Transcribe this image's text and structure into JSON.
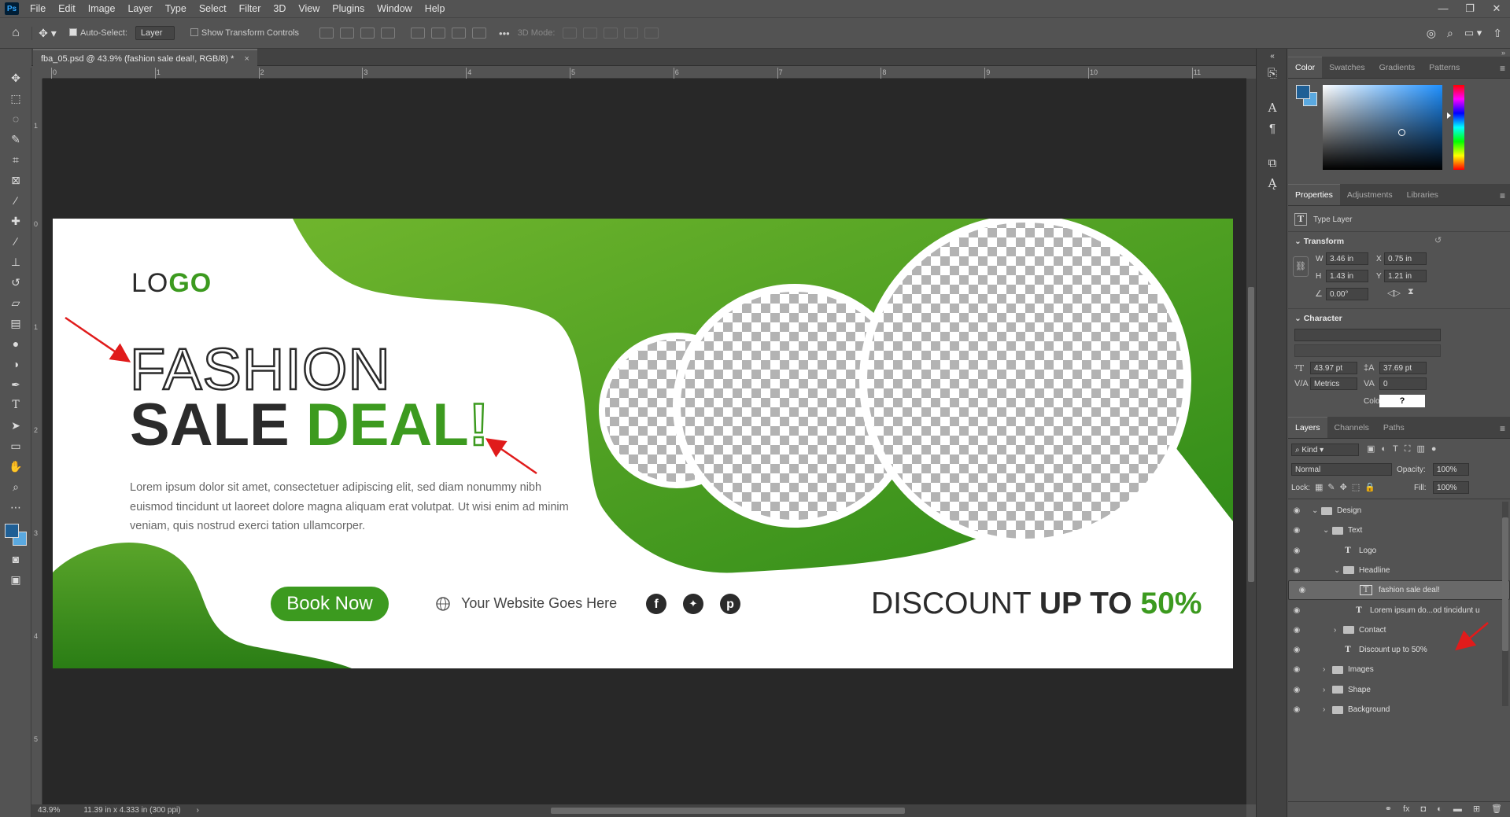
{
  "app": {
    "name": "Ps"
  },
  "menu": [
    "File",
    "Edit",
    "Image",
    "Layer",
    "Type",
    "Select",
    "Filter",
    "3D",
    "View",
    "Plugins",
    "Window",
    "Help"
  ],
  "window_controls": [
    "—",
    "❐",
    "✕"
  ],
  "options_bar": {
    "auto_select_label": "Auto-Select:",
    "auto_select_value": "Layer",
    "transform_label": "Show Transform Controls",
    "more": "•••",
    "mode_3d": "3D Mode:"
  },
  "document": {
    "tab_title": "fba_05.psd @ 43.9% (fashion sale deal!, RGB/8) *",
    "tab_close": "×",
    "zoom": "43.9%",
    "doc_size": "11.39 in x 4.333 in (300 ppi)"
  },
  "rulers": {
    "h": [
      "0",
      "1",
      "2",
      "3",
      "4",
      "5",
      "6",
      "7",
      "8",
      "9",
      "10",
      "11"
    ],
    "v": [
      "1",
      "0",
      "1",
      "2",
      "3",
      "4",
      "5"
    ]
  },
  "artwork": {
    "logo_dark": "LO",
    "logo_green": "GO",
    "headline_1": "FASHION",
    "headline_2a": "SALE",
    "headline_2b": "DEAL",
    "headline_2c": "!",
    "body": "Lorem ipsum dolor sit amet, consectetuer adipiscing elit, sed diam nonummy nibh euismod tincidunt ut laoreet dolore magna aliquam erat volutpat. Ut wisi enim ad minim veniam, quis nostrud exerci tation ullamcorper.",
    "button": "Book Now",
    "website": "Your Website Goes Here",
    "discount_a": "DISCOUNT",
    "discount_b": "UP TO",
    "discount_c": "50%",
    "green": "#3c9a1f",
    "dark": "#2b2b2b"
  },
  "color_panel": {
    "tabs": [
      "Color",
      "Swatches",
      "Gradients",
      "Patterns"
    ],
    "foreground": "#1f5f95",
    "background": "#5aa9e0"
  },
  "properties_panel": {
    "tabs": [
      "Properties",
      "Adjustments",
      "Libraries"
    ],
    "layer_type": "Type Layer",
    "transform_title": "Transform",
    "w_label": "W",
    "w": "3.46 in",
    "x_label": "X",
    "x": "0.75 in",
    "h_label": "H",
    "h": "1.43 in",
    "y_label": "Y",
    "y": "1.21 in",
    "angle": "0.00°",
    "character_title": "Character",
    "font_size": "43.97 pt",
    "leading": "37.69 pt",
    "kerning": "Metrics",
    "tracking": "0",
    "color_label": "Color",
    "color_value": "?"
  },
  "layers_panel": {
    "tabs": [
      "Layers",
      "Channels",
      "Paths"
    ],
    "filter": "Kind",
    "blend": "Normal",
    "opacity_label": "Opacity:",
    "opacity": "100%",
    "lock_label": "Lock:",
    "fill_label": "Fill:",
    "fill": "100%",
    "layers": [
      {
        "name": "Design",
        "type": "group",
        "indent": 0,
        "open": true
      },
      {
        "name": "Text",
        "type": "group",
        "indent": 1,
        "open": true
      },
      {
        "name": "Logo",
        "type": "text",
        "indent": 2
      },
      {
        "name": "Headline",
        "type": "group",
        "indent": 2,
        "open": true
      },
      {
        "name": "fashion sale deal!",
        "type": "text",
        "indent": 3,
        "selected": true
      },
      {
        "name": "Lorem ipsum do...od tincidunt u",
        "type": "text",
        "indent": 3
      },
      {
        "name": "Contact",
        "type": "group",
        "indent": 2,
        "open": false
      },
      {
        "name": "Discount up to 50%",
        "type": "text",
        "indent": 2
      },
      {
        "name": "Images",
        "type": "group",
        "indent": 1,
        "open": false
      },
      {
        "name": "Shape",
        "type": "group",
        "indent": 1,
        "open": false
      },
      {
        "name": "Background",
        "type": "group",
        "indent": 1,
        "open": false
      }
    ]
  }
}
